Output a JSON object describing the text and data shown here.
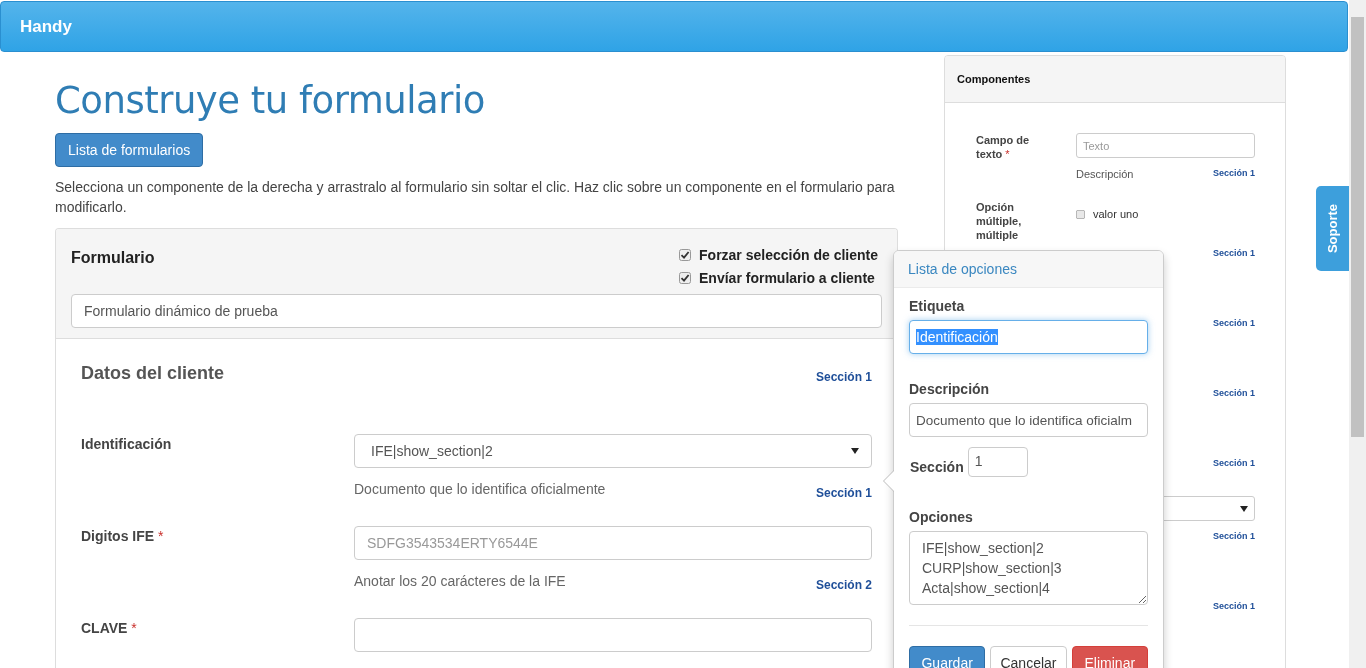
{
  "navbar": {
    "brand": "Handy"
  },
  "page": {
    "title": "Construye tu formulario",
    "list_button": "Lista de formularios",
    "instructions": "Selecciona un componente de la derecha y arrastralo al formulario sin soltar el clic. Haz clic sobre un componente en el formulario para modificarlo."
  },
  "form": {
    "title": "Formulario",
    "options": [
      {
        "label": "Forzar selección de cliente",
        "checked": true
      },
      {
        "label": "Envíar formulario a cliente",
        "checked": true
      }
    ],
    "name": "Formulario dinámico de prueba",
    "section_title": "Datos del cliente",
    "section_label": "Sección 1",
    "fields": [
      {
        "kind": "select",
        "label": "Identificación",
        "value": "IFE|show_section|2",
        "description": "Documento que lo identifica oficialmente",
        "section": "Sección 1"
      },
      {
        "kind": "text",
        "label": "Digitos IFE",
        "mark": "*",
        "placeholder": "SDFG3543534ERTY6544E",
        "description": "Anotar los 20 carácteres de la IFE",
        "section": "Sección 2"
      },
      {
        "kind": "text",
        "label": "CLAVE",
        "mark": "*"
      }
    ]
  },
  "components": {
    "title": "Componentes",
    "items": [
      {
        "kind": "text",
        "label": "Campo de texto",
        "mark": "*",
        "placeholder": "Texto",
        "description": "Descripción",
        "section": "Sección 1"
      },
      {
        "kind": "checkbox",
        "label": "Opción múltiple, múltiple",
        "options": [
          {
            "label": "valor uno",
            "checked": false
          }
        ],
        "section": "Sección 1"
      },
      {
        "kind": "covered",
        "section": "Sección 1"
      },
      {
        "kind": "covered",
        "section": "Sección 1"
      },
      {
        "kind": "covered",
        "section": "Sección 1"
      },
      {
        "kind": "select",
        "section": "Sección 1"
      },
      {
        "kind": "covered",
        "section": "Sección 1"
      }
    ]
  },
  "popover": {
    "title": "Lista de opciones",
    "label_caption": "Etiqueta",
    "label_value": "Identificación",
    "label_highlighted": true,
    "description_caption": "Descripción",
    "description_value": "Documento que lo identifica oficialm",
    "section_caption": "Sección",
    "section_value": "1",
    "options_caption": "Opciones",
    "options_lines": [
      "IFE|show_section|2",
      "CURP|show_section|3",
      "Acta|show_section|4"
    ],
    "buttons": [
      {
        "label": "Guardar",
        "kind": "primary"
      },
      {
        "label": "Cancelar",
        "kind": "default"
      },
      {
        "label": "Eliminar",
        "kind": "danger"
      }
    ]
  },
  "support_tab": "Soporte"
}
